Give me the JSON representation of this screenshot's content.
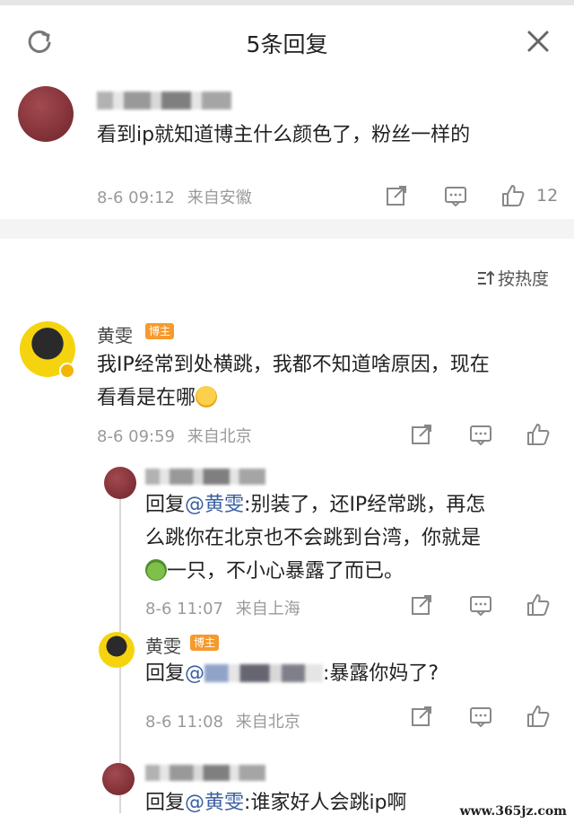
{
  "header": {
    "title": "5条回复",
    "refresh_icon": "refresh-icon",
    "close_icon": "close-icon"
  },
  "top_comment": {
    "text": "看到ip就知道博主什么颜色了，粉丝一样的",
    "time": "8-6 09:12",
    "location": "来自安徽",
    "likes": "12"
  },
  "sort": {
    "label": "按热度"
  },
  "main_comment": {
    "name": "黄雯",
    "badge": "博主",
    "text_line1": "我IP经常到处横跳，我都不知道啥原因，现在",
    "text_line2": "看看是在哪",
    "time": "8-6 09:59",
    "location": "来自北京"
  },
  "replies": [
    {
      "prefix": "回复",
      "mention": "@黄雯",
      "line1_rest": ":别装了，还IP经常跳，再怎",
      "line2": "么跳你在北京也不会跳到台湾，你就是",
      "line3": "一只，不小心暴露了而已。",
      "time": "8-6 11:07",
      "location": "来自上海"
    },
    {
      "name": "黄雯",
      "badge": "博主",
      "prefix": "回复",
      "mention": "@",
      "text_rest": ":暴露你妈了?",
      "time": "8-6 11:08",
      "location": "来自北京"
    },
    {
      "prefix": "回复",
      "mention": "@黄雯",
      "text_rest": ":谁家好人会跳ip啊"
    }
  ],
  "watermark": "www.365jz.com",
  "colors": {
    "mention": "#3a5fa0",
    "badge": "#f79a2d",
    "background": "#f4f4f4"
  }
}
